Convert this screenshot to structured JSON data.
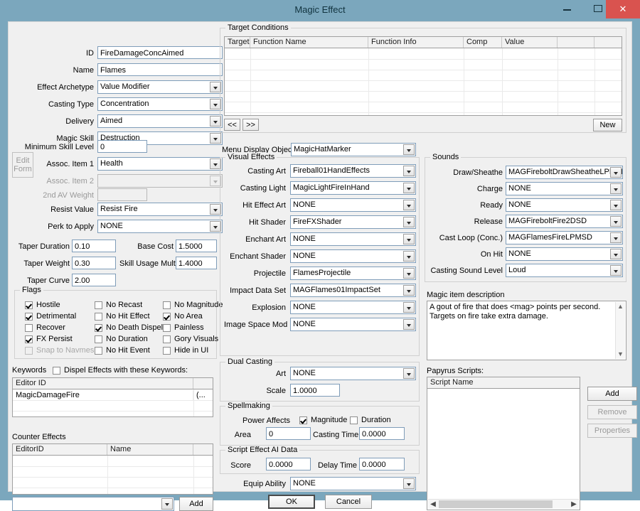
{
  "window": {
    "title": "Magic Effect",
    "minimize_glyph": "minimize-icon",
    "maximize_glyph": "maximize-icon",
    "close_glyph": "✕"
  },
  "left": {
    "fields": [
      {
        "label": "ID",
        "value": "FireDamageConcAimed",
        "type": "text"
      },
      {
        "label": "Name",
        "value": "Flames",
        "type": "text"
      },
      {
        "label": "Effect Archetype",
        "value": "Value Modifier",
        "type": "combo"
      },
      {
        "label": "Casting Type",
        "value": "Concentration",
        "type": "combo"
      },
      {
        "label": "Delivery",
        "value": "Aimed",
        "type": "combo"
      },
      {
        "label": "Magic Skill",
        "value": "Destruction",
        "type": "combo"
      },
      {
        "label": "Minimum Skill Level",
        "value": "0",
        "type": "text"
      },
      {
        "label": "Assoc. Item 1",
        "value": "Health",
        "type": "combo"
      },
      {
        "label": "Assoc. Item 2",
        "value": "",
        "type": "combo",
        "disabled": true
      },
      {
        "label": "2nd AV Weight",
        "value": "",
        "type": "text",
        "disabled": true
      },
      {
        "label": "Resist Value",
        "value": "Resist Fire",
        "type": "combo"
      },
      {
        "label": "Perk to Apply",
        "value": "NONE",
        "type": "combo"
      }
    ],
    "edit_form_button": "Edit\nForm",
    "edit_form_line1": "Edit",
    "edit_form_line2": "Form",
    "taper": [
      {
        "label": "Taper Duration",
        "value": "0.10"
      },
      {
        "label": "Taper Weight",
        "value": "0.30"
      },
      {
        "label": "Taper Curve",
        "value": "2.00"
      }
    ],
    "cost": [
      {
        "label": "Base Cost",
        "value": "1.5000"
      },
      {
        "label": "Skill Usage Mult",
        "value": "1.4000"
      }
    ],
    "flags": {
      "title": "Flags",
      "col1": [
        {
          "label": "Hostile",
          "checked": true
        },
        {
          "label": "Detrimental",
          "checked": true
        },
        {
          "label": "Recover",
          "checked": false
        },
        {
          "label": "FX Persist",
          "checked": true
        },
        {
          "label": "Snap to Navmesh",
          "checked": false,
          "disabled": true
        }
      ],
      "col2": [
        {
          "label": "No Recast",
          "checked": false
        },
        {
          "label": "No Hit Effect",
          "checked": false
        },
        {
          "label": "No Death Dispel",
          "checked": true
        },
        {
          "label": "No Duration",
          "checked": false
        },
        {
          "label": "No Hit Event",
          "checked": false
        }
      ],
      "col3": [
        {
          "label": "No Magnitude",
          "checked": false
        },
        {
          "label": "No Area",
          "checked": true
        },
        {
          "label": "Painless",
          "checked": false
        },
        {
          "label": "Gory Visuals",
          "checked": false
        },
        {
          "label": "Hide in UI",
          "checked": false
        }
      ]
    },
    "keywords": {
      "label": "Keywords",
      "dispel_checkbox": "Dispel Effects with these Keywords:",
      "dispel_checked": false,
      "columns": [
        "Editor ID",
        ""
      ],
      "rows": [
        {
          "editor_id": "MagicDamageFire",
          "extra": "(..."
        }
      ]
    },
    "counter_effects": {
      "label": "Counter Effects",
      "columns": [
        "EditorID",
        "Name",
        ""
      ],
      "rows": []
    },
    "add_combo_value": "",
    "add_button": "Add"
  },
  "target_conditions": {
    "title": "Target Conditions",
    "columns": [
      "Target",
      "Function Name",
      "Function Info",
      "Comp",
      "Value",
      "",
      ""
    ],
    "rows": [],
    "prev_button": "<<",
    "next_button": ">>",
    "new_button": "New"
  },
  "middle": {
    "menu_display_object": {
      "label": "Menu Display Object",
      "value": "MagicHatMarker"
    },
    "visual_effects": {
      "title": "Visual Effects",
      "fields": [
        {
          "label": "Casting Art",
          "value": "Fireball01HandEffects"
        },
        {
          "label": "Casting Light",
          "value": "MagicLightFireInHand"
        },
        {
          "label": "Hit Effect Art",
          "value": "NONE"
        },
        {
          "label": "Hit Shader",
          "value": "FireFXShader"
        },
        {
          "label": "Enchant Art",
          "value": "NONE"
        },
        {
          "label": "Enchant Shader",
          "value": "NONE"
        },
        {
          "label": "Projectile",
          "value": "FlamesProjectile"
        },
        {
          "label": "Impact Data Set",
          "value": "MAGFlames01ImpactSet"
        },
        {
          "label": "Explosion",
          "value": "NONE"
        },
        {
          "label": "Image Space Mod",
          "value": "NONE"
        }
      ]
    },
    "dual_casting": {
      "title": "Dual Casting",
      "art_label": "Art",
      "art_value": "NONE",
      "scale_label": "Scale",
      "scale_value": "1.0000"
    },
    "spellmaking": {
      "title": "Spellmaking",
      "power_affects_label": "Power Affects",
      "magnitude_label": "Magnitude",
      "magnitude_checked": true,
      "duration_label": "Duration",
      "duration_checked": false,
      "area_label": "Area",
      "area_value": "0",
      "casting_time_label": "Casting Time",
      "casting_time_value": "0.0000"
    },
    "script_ai": {
      "title": "Script Effect AI Data",
      "score_label": "Score",
      "score_value": "0.0000",
      "delay_label": "Delay Time",
      "delay_value": "0.0000"
    },
    "equip_ability": {
      "label": "Equip Ability",
      "value": "NONE"
    },
    "ok_button": "OK",
    "cancel_button": "Cancel"
  },
  "right": {
    "sounds": {
      "title": "Sounds",
      "fields": [
        {
          "label": "Draw/Sheathe",
          "value": "MAGFireboltDrawSheatheLPMSD"
        },
        {
          "label": "Charge",
          "value": "NONE"
        },
        {
          "label": "Ready",
          "value": "NONE"
        },
        {
          "label": "Release",
          "value": "MAGFireboltFire2DSD"
        },
        {
          "label": "Cast Loop (Conc.)",
          "value": "MAGFlamesFireLPMSD"
        },
        {
          "label": "On Hit",
          "value": "NONE"
        },
        {
          "label": "Casting Sound Level",
          "value": "Loud"
        }
      ]
    },
    "description": {
      "label": "Magic item description",
      "value": "A gout of fire that does <mag> points per second. Targets on fire take extra damage."
    },
    "papyrus": {
      "label": "Papyrus Scripts:",
      "column": "Script Name",
      "rows": [],
      "add_button": "Add",
      "remove_button": "Remove",
      "properties_button": "Properties"
    }
  }
}
